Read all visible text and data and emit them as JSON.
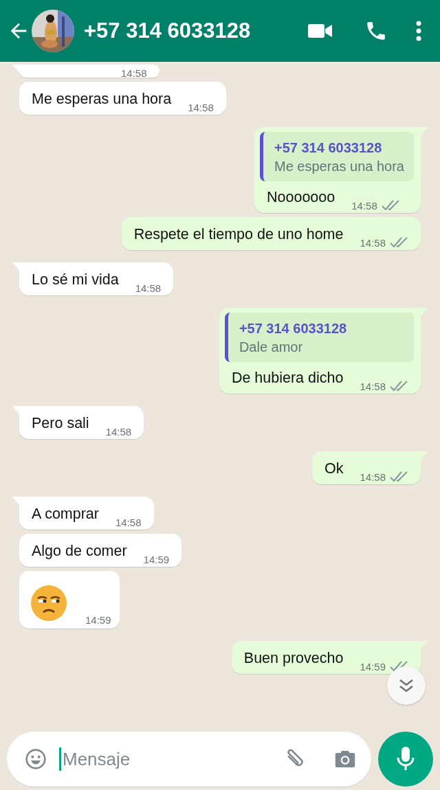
{
  "header": {
    "title": "+57 314 6033128"
  },
  "messages": [
    {
      "outgoing": false,
      "partial": true,
      "time": "14:58"
    },
    {
      "outgoing": false,
      "text": "Me esperas una hora",
      "time": "14:58"
    },
    {
      "outgoing": true,
      "quote": {
        "author": "+57 314 6033128",
        "text": "Me esperas una hora"
      },
      "text": "Nooooooo",
      "time": "14:58",
      "read": false
    },
    {
      "outgoing": true,
      "text": "Respete el tiempo de uno home",
      "time": "14:58",
      "read": false
    },
    {
      "outgoing": false,
      "text": "Lo sé mi vida",
      "time": "14:58"
    },
    {
      "outgoing": true,
      "quote": {
        "author": "+57 314 6033128",
        "text": "Dale amor"
      },
      "text": "De hubiera dicho",
      "time": "14:58",
      "read": false
    },
    {
      "outgoing": false,
      "text": "Pero sali",
      "time": "14:58"
    },
    {
      "outgoing": true,
      "text": "Ok",
      "time": "14:58",
      "read": false
    },
    {
      "outgoing": false,
      "text": "A comprar",
      "time": "14:58"
    },
    {
      "outgoing": false,
      "text": "Algo de comer",
      "time": "14:59"
    },
    {
      "outgoing": false,
      "kind": "emoji",
      "time": "14:59"
    },
    {
      "outgoing": true,
      "text": "Buen provecho",
      "time": "14:59",
      "read": false
    }
  ],
  "composer": {
    "placeholder": "Mensaje"
  }
}
